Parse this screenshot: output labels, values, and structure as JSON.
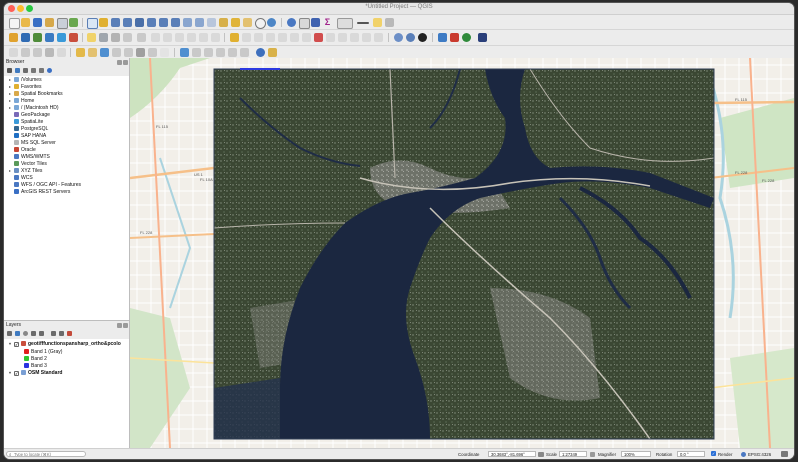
{
  "window": {
    "title": "*Untitled Project — QGIS"
  },
  "browser_panel": {
    "title": "Browser",
    "items": [
      {
        "label": "/Volumes",
        "icon": "folder-icon",
        "expandable": true
      },
      {
        "label": "Favorites",
        "icon": "star-icon",
        "expandable": true
      },
      {
        "label": "Spatial Bookmarks",
        "icon": "bookmark-icon",
        "expandable": true
      },
      {
        "label": "Home",
        "icon": "folder-icon",
        "expandable": true
      },
      {
        "label": "/ (Macintosh HD)",
        "icon": "folder-icon",
        "expandable": true
      },
      {
        "label": "GeoPackage",
        "icon": "geopackage-icon",
        "expandable": false
      },
      {
        "label": "SpatiaLite",
        "icon": "spatialite-icon",
        "expandable": false
      },
      {
        "label": "PostgreSQL",
        "icon": "postgresql-icon",
        "expandable": false
      },
      {
        "label": "SAP HANA",
        "icon": "sap-hana-icon",
        "expandable": false
      },
      {
        "label": "MS SQL Server",
        "icon": "mssql-icon",
        "expandable": false
      },
      {
        "label": "Oracle",
        "icon": "oracle-icon",
        "expandable": false
      },
      {
        "label": "WMS/WMTS",
        "icon": "wms-icon",
        "expandable": false
      },
      {
        "label": "Vector Tiles",
        "icon": "vector-tiles-icon",
        "expandable": false
      },
      {
        "label": "XYZ Tiles",
        "icon": "xyz-tiles-icon",
        "expandable": true
      },
      {
        "label": "WCS",
        "icon": "wcs-icon",
        "expandable": false
      },
      {
        "label": "WFS / OGC API - Features",
        "icon": "wfs-icon",
        "expandable": false
      },
      {
        "label": "ArcGIS REST Servers",
        "icon": "arcgis-icon",
        "expandable": false
      }
    ]
  },
  "layers_panel": {
    "title": "Layers",
    "layers": [
      {
        "label": "geotifffunctionspansharp_ortho&pcolo",
        "bold": true,
        "bands": [
          {
            "label": "Band 1 (Gray)",
            "color": "#e0201f"
          },
          {
            "label": "Band 2",
            "color": "#2fc52f"
          },
          {
            "label": "Band 3",
            "color": "#2a34e0"
          }
        ]
      },
      {
        "label": "OSM Standard",
        "bold": true,
        "bands": []
      }
    ]
  },
  "map": {
    "road_labels": [
      "FL 115",
      "FL 115",
      "US 1",
      "FL 10A",
      "FL 228",
      "FL 228",
      "FL 228"
    ]
  },
  "statusbar": {
    "locator_placeholder": "Type to locate (⌘K)",
    "coordinate_label": "Coordinate",
    "coordinate_value": "30.3683°,-81.696°",
    "scale_label": "Scale",
    "scale_value": "1:27349",
    "magnifier_label": "Magnifier",
    "magnifier_value": "100%",
    "rotation_label": "Rotation",
    "rotation_value": "0.0 °",
    "render_label": "Render",
    "crs_label": "EPSG:4326"
  },
  "colors": {
    "water_dark": "#1b2740",
    "vegetation": "#3d4a33",
    "osm_land": "#f2efe9",
    "osm_water": "#aad3df",
    "major_road": "#f6c089"
  }
}
